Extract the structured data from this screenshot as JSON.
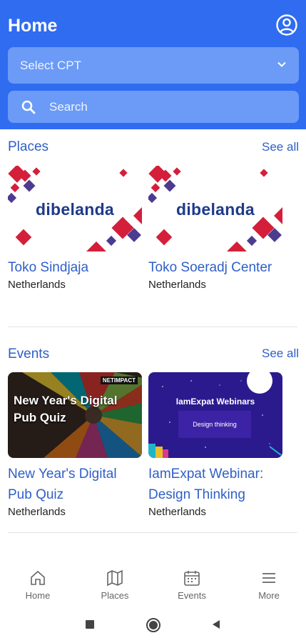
{
  "header": {
    "title": "Home",
    "select_label": "Select CPT",
    "search_placeholder": "Search",
    "background": "#2f6cf0"
  },
  "places": {
    "title": "Places",
    "see_all": "See all",
    "items": [
      {
        "name": "Toko Sindjaja",
        "country": "Netherlands",
        "logo": "dibelanda"
      },
      {
        "name": "Toko Soeradj Center",
        "country": "Netherlands",
        "logo": "dibelanda"
      }
    ]
  },
  "events": {
    "title": "Events",
    "see_all": "See all",
    "items": [
      {
        "name": "New Year's Digital Pub Quiz",
        "country": "Netherlands",
        "image_title": "New Year's Digital Pub Quiz",
        "image_tag": "NETIMPACT"
      },
      {
        "name": "IamExpat Webinar: Design Thinking",
        "country": "Netherlands",
        "image_title": "IamExpat Webinars",
        "image_subtitle": "Design thinking"
      }
    ]
  },
  "bottom_nav": [
    {
      "label": "Home",
      "icon": "home-icon"
    },
    {
      "label": "Places",
      "icon": "map-icon"
    },
    {
      "label": "Events",
      "icon": "calendar-icon"
    },
    {
      "label": "More",
      "icon": "menu-icon"
    }
  ],
  "colors": {
    "primary": "#2f6cf0",
    "field": "#6b9bf6",
    "link": "#2f5fc8"
  }
}
